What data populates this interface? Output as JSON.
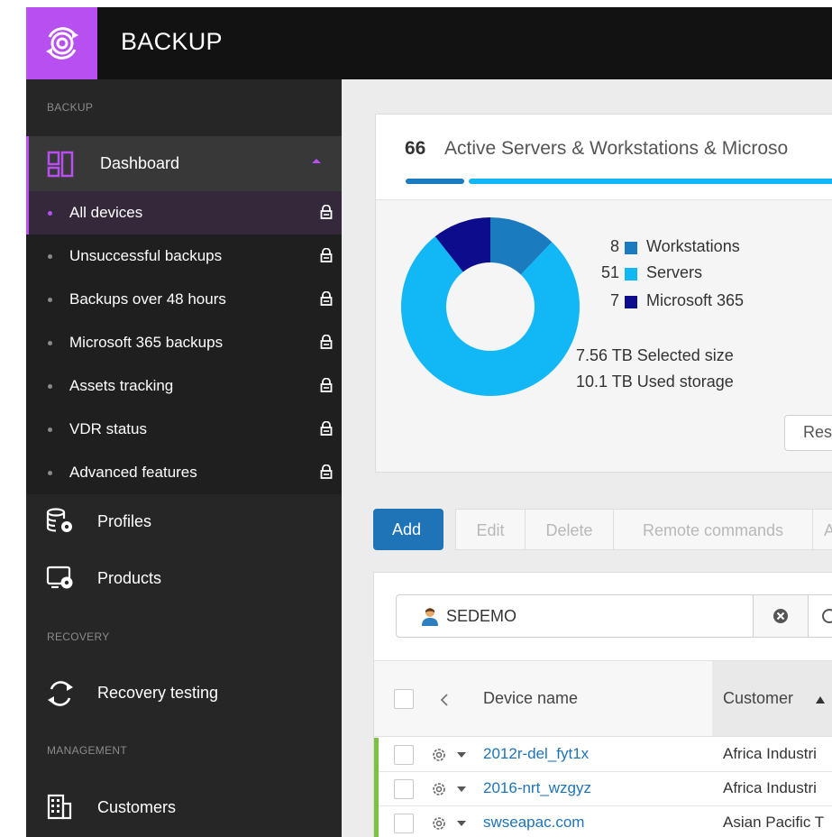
{
  "app": {
    "title": "BACKUP",
    "brand_color": "#b84ff0"
  },
  "sidebar": {
    "section_backup": "BACKUP",
    "dashboard_label": "Dashboard",
    "sub_items": [
      {
        "label": "All devices",
        "active": true
      },
      {
        "label": "Unsuccessful backups"
      },
      {
        "label": "Backups over 48 hours"
      },
      {
        "label": "Microsoft 365 backups"
      },
      {
        "label": "Assets tracking"
      },
      {
        "label": "VDR status"
      },
      {
        "label": "Advanced features"
      }
    ],
    "profiles_label": "Profiles",
    "products_label": "Products",
    "section_recovery": "RECOVERY",
    "recovery_testing_label": "Recovery testing",
    "section_management": "MANAGEMENT",
    "customers_label": "Customers"
  },
  "summary": {
    "count": "66",
    "title": "Active Servers & Workstations & Microso",
    "legend": [
      {
        "value": "8",
        "label": "Workstations",
        "color": "#1a7bbf"
      },
      {
        "value": "51",
        "label": "Servers",
        "color": "#12b8f5"
      },
      {
        "value": "7",
        "label": "Microsoft 365",
        "color": "#0c0c8c"
      }
    ],
    "selected_size": "7.56 TB  Selected size",
    "used_storage": "10.1 TB  Used storage",
    "reset_button": "Res"
  },
  "toolbar": {
    "add": "Add",
    "edit": "Edit",
    "delete": "Delete",
    "remote_commands": "Remote commands",
    "more": "A"
  },
  "search": {
    "value": "SEDEMO"
  },
  "table": {
    "columns": {
      "device_name": "Device name",
      "customer": "Customer"
    },
    "rows": [
      {
        "device": "2012r-del_fyt1x",
        "customer": "Africa Industri"
      },
      {
        "device": "2016-nrt_wzgyz",
        "customer": "Africa Industri"
      },
      {
        "device": "swseapac.com",
        "customer": "Asian Pacific T"
      }
    ]
  }
}
